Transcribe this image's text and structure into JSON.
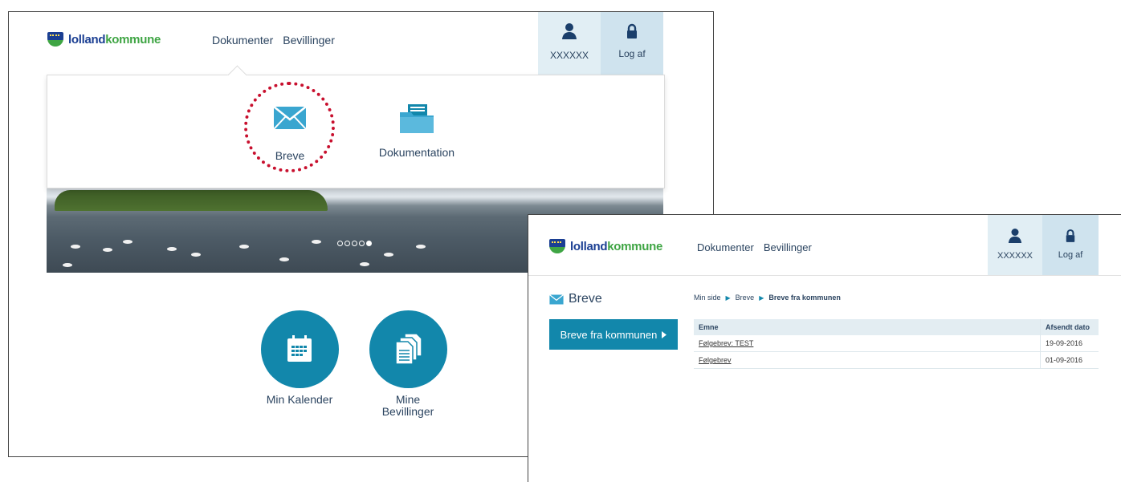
{
  "brand": {
    "logo_bold": "lolland",
    "logo_light": "kommune"
  },
  "nav": {
    "documents": "Dokumenter",
    "grants": "Bevillinger"
  },
  "user": {
    "name": "XXXXXX",
    "logout": "Log af"
  },
  "dropdown": {
    "items": [
      {
        "label": "Breve",
        "icon": "envelope-icon"
      },
      {
        "label": "Dokumentation",
        "icon": "folder-icon"
      }
    ]
  },
  "carousel": {
    "slides": 5,
    "active_index": 4
  },
  "tiles": [
    {
      "label": "Min Kalender",
      "icon": "calendar-icon"
    },
    {
      "label": "Mine\nBevillinger",
      "icon": "documents-icon"
    }
  ],
  "letters_page": {
    "title": "Breve",
    "side_button": "Breve fra kommunen",
    "breadcrumb": [
      "Min side",
      "Breve",
      "Breve fra kommunen"
    ],
    "table": {
      "columns": [
        "Emne",
        "Afsendt dato"
      ],
      "rows": [
        {
          "subject": "Følgebrev: TEST",
          "date": "19-09-2016"
        },
        {
          "subject": "Følgebrev",
          "date": "01-09-2016"
        }
      ]
    }
  },
  "colors": {
    "accent": "#1287ab",
    "highlight": "#c8102e",
    "brand_blue": "#1b3f93",
    "brand_green": "#3fa544"
  }
}
